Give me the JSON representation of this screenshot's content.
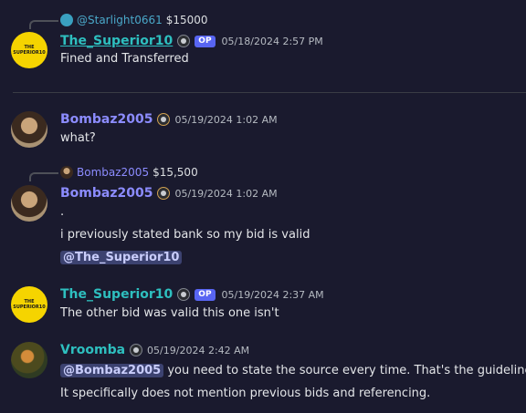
{
  "messages": [
    {
      "reply": {
        "user": "@Starlight0661",
        "text": "$15000",
        "user_color": "#4aa8c9"
      },
      "author": "The_Superior10",
      "author_color": "#2ebfbf",
      "op_badge": "OP",
      "timestamp": "05/18/2024 2:57 PM",
      "lines": [
        "Fined and Transferred"
      ],
      "avatar_text": "THE SUPERIOR10"
    },
    {
      "author": "Bombaz2005",
      "author_color": "#8c8cff",
      "timestamp": "05/19/2024 1:02 AM",
      "lines": [
        "what?"
      ]
    },
    {
      "reply": {
        "user": "Bombaz2005",
        "text": "$15,500",
        "user_color": "#8c8cff"
      },
      "author": "Bombaz2005",
      "author_color": "#8c8cff",
      "timestamp": "05/19/2024 1:02 AM",
      "lines": [
        ".",
        "i previously stated bank so my bid is valid"
      ],
      "mention": "@The_Superior10"
    },
    {
      "author": "The_Superior10",
      "author_color": "#2ebfbf",
      "op_badge": "OP",
      "timestamp": "05/19/2024 2:37 AM",
      "lines": [
        "The other bid was valid this one isn't"
      ],
      "avatar_text": "THE SUPERIOR10"
    },
    {
      "author": "Vroomba",
      "author_color": "#2ebfbf",
      "timestamp": "05/19/2024 2:42 AM",
      "mention": "@Bombaz2005",
      "line_after_mention": " you need to state the source every time. That's the guideline.",
      "lines": [
        "It specifically does not mention previous bids and referencing."
      ]
    }
  ]
}
